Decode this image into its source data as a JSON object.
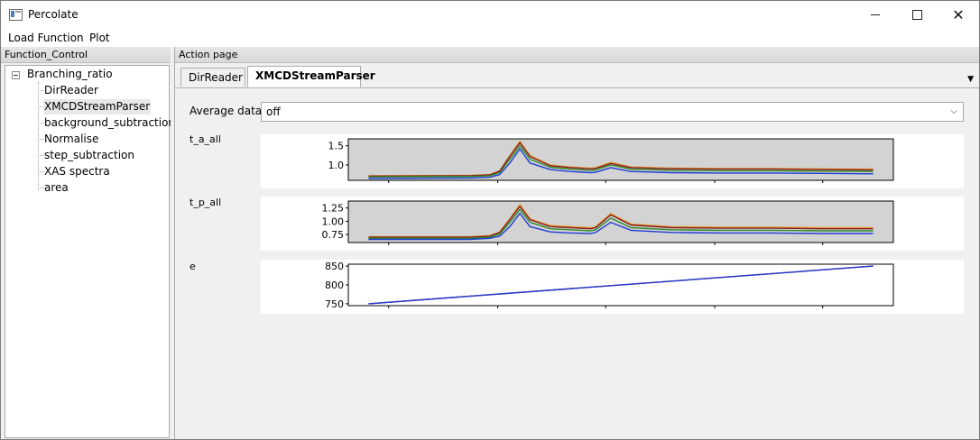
{
  "window": {
    "title": "Percolate"
  },
  "menu": {
    "load_function": "Load Function",
    "plot": "Plot"
  },
  "left_panel": {
    "header": "Function_Control",
    "tree": {
      "root": "Branching_ratio",
      "items": [
        {
          "label": "DirReader",
          "selected": false
        },
        {
          "label": "XMCDStreamParser",
          "selected": true
        },
        {
          "label": "background_subtraction",
          "selected": false
        },
        {
          "label": "Normalise",
          "selected": false
        },
        {
          "label": "step_subtraction",
          "selected": false
        },
        {
          "label": "XAS spectra",
          "selected": false
        },
        {
          "label": "area",
          "selected": false
        }
      ]
    }
  },
  "right_panel": {
    "header": "Action page",
    "tabs": [
      {
        "label": "DirReader",
        "active": false
      },
      {
        "label": "XMCDStreamParser",
        "active": true
      }
    ],
    "average_data": {
      "label": "Average data",
      "value": "off"
    }
  },
  "chart_data": [
    {
      "type": "line",
      "title": "t_a_all",
      "background": "#d3d3d3",
      "yticks": [
        "1.5",
        "1.0"
      ],
      "ylim": [
        0.6,
        1.68
      ],
      "xlim": [
        -2,
        52
      ],
      "xticks_labeled": false,
      "series": [
        {
          "color": "#e0a040",
          "x": [
            0,
            10,
            12,
            13,
            14,
            15,
            16,
            18,
            20,
            22,
            22.5,
            24,
            26,
            30,
            35,
            40,
            45,
            50
          ],
          "y": [
            0.72,
            0.73,
            0.75,
            0.85,
            1.25,
            1.62,
            1.25,
            1.0,
            0.95,
            0.92,
            0.93,
            1.07,
            0.95,
            0.92,
            0.91,
            0.91,
            0.9,
            0.89
          ]
        },
        {
          "color": "#8b1a1a",
          "x": [
            0,
            10,
            12,
            13,
            14,
            15,
            16,
            18,
            20,
            22,
            22.5,
            24,
            26,
            30,
            35,
            40,
            45,
            50
          ],
          "y": [
            0.71,
            0.72,
            0.74,
            0.84,
            1.22,
            1.58,
            1.22,
            0.98,
            0.93,
            0.9,
            0.91,
            1.04,
            0.93,
            0.9,
            0.89,
            0.89,
            0.88,
            0.87
          ]
        },
        {
          "color": "#2a8a2a",
          "x": [
            0,
            10,
            12,
            13,
            14,
            15,
            16,
            18,
            20,
            22,
            22.5,
            24,
            26,
            30,
            35,
            40,
            45,
            50
          ],
          "y": [
            0.69,
            0.7,
            0.72,
            0.8,
            1.15,
            1.5,
            1.15,
            0.94,
            0.89,
            0.86,
            0.87,
            1.0,
            0.89,
            0.86,
            0.85,
            0.85,
            0.84,
            0.83
          ]
        },
        {
          "color": "#1f3ad6",
          "x": [
            0,
            10,
            12,
            13,
            14,
            15,
            16,
            18,
            20,
            22,
            22.5,
            24,
            26,
            30,
            35,
            40,
            45,
            50
          ],
          "y": [
            0.65,
            0.66,
            0.68,
            0.75,
            1.05,
            1.42,
            1.05,
            0.88,
            0.83,
            0.8,
            0.81,
            0.93,
            0.83,
            0.8,
            0.79,
            0.79,
            0.78,
            0.77
          ]
        }
      ]
    },
    {
      "type": "line",
      "title": "t_p_all",
      "background": "#d3d3d3",
      "yticks": [
        "1.25",
        "1.00",
        "0.75"
      ],
      "ylim": [
        0.6,
        1.38
      ],
      "xlim": [
        -2,
        52
      ],
      "xticks_labeled": false,
      "series": [
        {
          "color": "#e0a040",
          "x": [
            0,
            10,
            12,
            13,
            14,
            15,
            16,
            18,
            20,
            22,
            22.5,
            24,
            26,
            30,
            35,
            40,
            45,
            50
          ],
          "y": [
            0.71,
            0.71,
            0.73,
            0.8,
            1.05,
            1.32,
            1.05,
            0.92,
            0.9,
            0.88,
            0.9,
            1.15,
            0.95,
            0.9,
            0.89,
            0.89,
            0.88,
            0.88
          ]
        },
        {
          "color": "#8b1a1a",
          "x": [
            0,
            10,
            12,
            13,
            14,
            15,
            16,
            18,
            20,
            22,
            22.5,
            24,
            26,
            30,
            35,
            40,
            45,
            50
          ],
          "y": [
            0.7,
            0.7,
            0.72,
            0.79,
            1.03,
            1.28,
            1.03,
            0.9,
            0.88,
            0.86,
            0.88,
            1.12,
            0.93,
            0.88,
            0.87,
            0.87,
            0.86,
            0.86
          ]
        },
        {
          "color": "#2a8a2a",
          "x": [
            0,
            10,
            12,
            13,
            14,
            15,
            16,
            18,
            20,
            22,
            22.5,
            24,
            26,
            30,
            35,
            40,
            45,
            50
          ],
          "y": [
            0.68,
            0.68,
            0.7,
            0.76,
            0.98,
            1.22,
            0.98,
            0.86,
            0.84,
            0.82,
            0.84,
            1.06,
            0.88,
            0.84,
            0.83,
            0.83,
            0.82,
            0.82
          ]
        },
        {
          "color": "#1f3ad6",
          "x": [
            0,
            10,
            12,
            13,
            14,
            15,
            16,
            18,
            20,
            22,
            22.5,
            24,
            26,
            30,
            35,
            40,
            45,
            50
          ],
          "y": [
            0.66,
            0.66,
            0.68,
            0.72,
            0.9,
            1.15,
            0.9,
            0.8,
            0.78,
            0.77,
            0.79,
            0.98,
            0.83,
            0.79,
            0.78,
            0.78,
            0.77,
            0.77
          ]
        }
      ]
    },
    {
      "type": "line",
      "title": "e",
      "background": "#ffffff",
      "yticks": [
        "850",
        "800",
        "750"
      ],
      "ylim": [
        745,
        855
      ],
      "xlim": [
        -2,
        52
      ],
      "xticks_labeled": false,
      "series": [
        {
          "color": "#8b1a1a",
          "x": [
            0,
            50
          ],
          "y": [
            750,
            850
          ]
        },
        {
          "color": "#1f3ad6",
          "x": [
            0,
            50
          ],
          "y": [
            750,
            850
          ]
        }
      ]
    }
  ]
}
